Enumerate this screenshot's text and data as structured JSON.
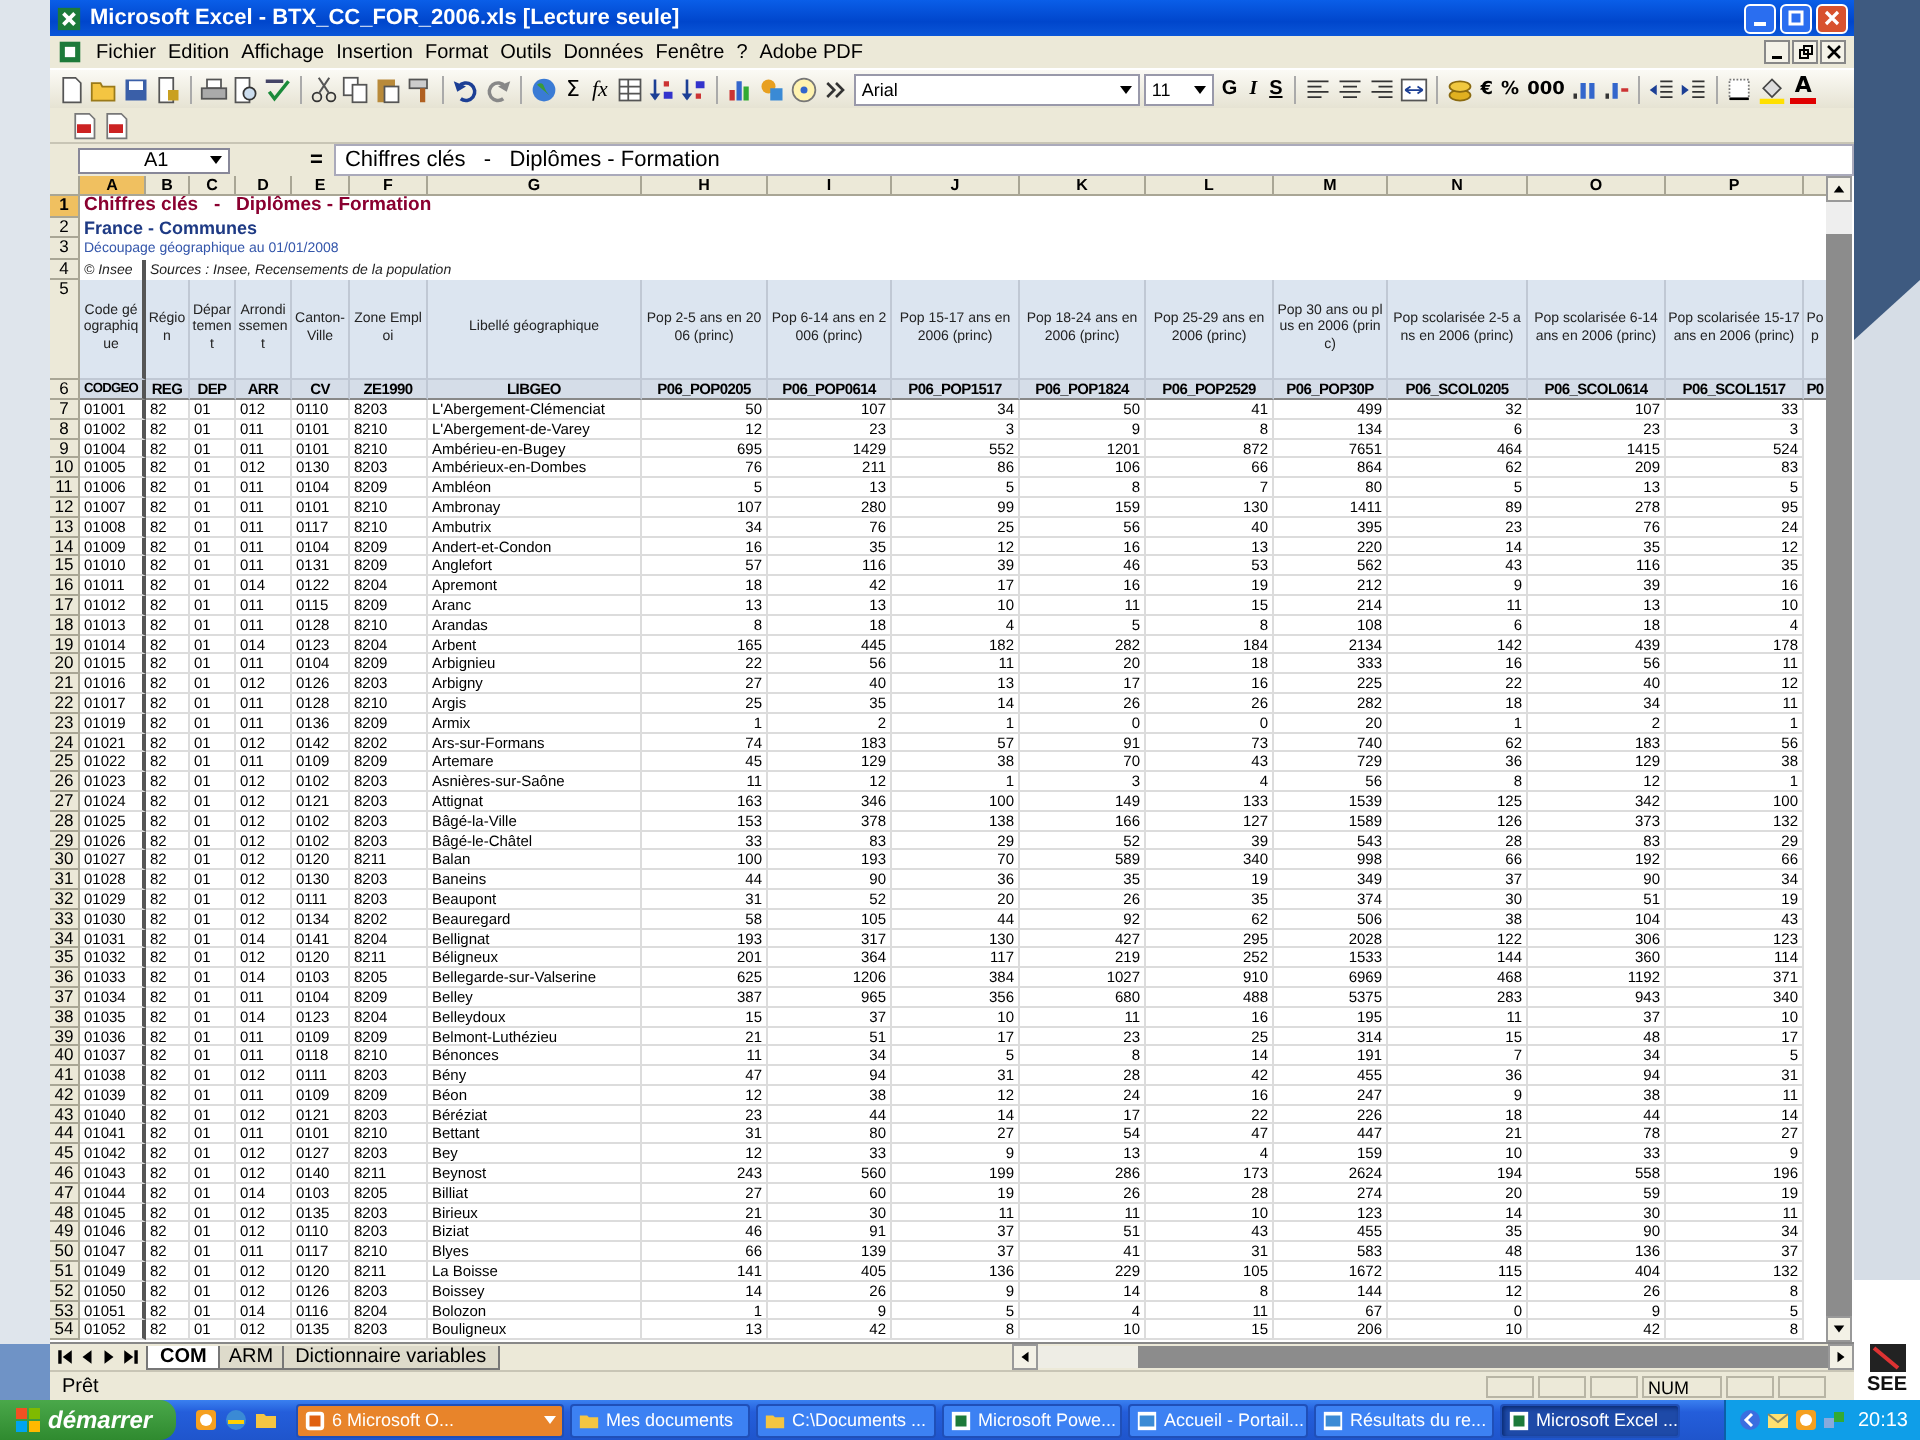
{
  "window": {
    "title": "Microsoft Excel - BTX_CC_FOR_2006.xls  [Lecture seule]"
  },
  "menu": [
    "Fichier",
    "Edition",
    "Affichage",
    "Insertion",
    "Format",
    "Outils",
    "Données",
    "Fenêtre",
    "?",
    "Adobe PDF"
  ],
  "toolbar": {
    "sum": "Σ",
    "function": "fx",
    "font": "Arial",
    "font_size": "11",
    "style_buttons": [
      "G",
      "I",
      "S"
    ],
    "number_buttons": [
      "€",
      "%",
      "000"
    ],
    "font_color": "A"
  },
  "formula_bar": {
    "name_box": "A1",
    "equals": "=",
    "content": "Chiffres clés   -   Diplômes - Formation"
  },
  "columns": [
    {
      "letter": "A",
      "selected": true
    },
    {
      "letter": "B",
      "selected": false
    },
    {
      "letter": "C",
      "selected": false
    },
    {
      "letter": "D",
      "selected": false
    },
    {
      "letter": "E",
      "selected": false
    },
    {
      "letter": "F",
      "selected": false
    },
    {
      "letter": "G",
      "selected": false
    },
    {
      "letter": "H",
      "selected": false
    },
    {
      "letter": "I",
      "selected": false
    },
    {
      "letter": "J",
      "selected": false
    },
    {
      "letter": "K",
      "selected": false
    },
    {
      "letter": "L",
      "selected": false
    },
    {
      "letter": "M",
      "selected": false
    },
    {
      "letter": "N",
      "selected": false
    },
    {
      "letter": "O",
      "selected": false
    },
    {
      "letter": "P",
      "selected": false
    }
  ],
  "title_rows": [
    {
      "row": "1",
      "kind": "title",
      "text": "Chiffres clés   -   Diplômes - Formation",
      "selected": true
    },
    {
      "row": "2",
      "kind": "subtitle",
      "text": "France - Communes",
      "selected": false
    },
    {
      "row": "3",
      "kind": "note",
      "text": "Découpage géographique au 01/01/2008",
      "selected": false
    },
    {
      "row": "4",
      "kind": "source",
      "copyright": "© Insee",
      "text": "Sources : Insee, Recensements de la population",
      "selected": false
    }
  ],
  "header_row": {
    "row": "5",
    "labels": [
      "Code géographique",
      "Région",
      "Département",
      "Arrondissement",
      "Canton-Ville",
      "Zone Emploi",
      "Libellé géographique",
      "Pop 2-5 ans en 2006 (princ)",
      "Pop 6-14 ans en 2006 (princ)",
      "Pop 15-17 ans en 2006 (princ)",
      "Pop 18-24 ans en 2006 (princ)",
      "Pop 25-29 ans en 2006 (princ)",
      "Pop 30 ans ou plus en 2006 (princ)",
      "Pop scolarisée 2-5 ans en 2006 (princ)",
      "Pop scolarisée 6-14 ans en 2006 (princ)",
      "Pop scolarisée 15-17 ans en 2006 (princ)",
      "Pop"
    ]
  },
  "code_row": {
    "row": "6",
    "codes": [
      "CODGEO",
      "REG",
      "DEP",
      "ARR",
      "CV",
      "ZE1990",
      "LIBGEO",
      "P06_POP0205",
      "P06_POP0614",
      "P06_POP1517",
      "P06_POP1824",
      "P06_POP2529",
      "P06_POP30P",
      "P06_SCOL0205",
      "P06_SCOL0614",
      "P06_SCOL1517",
      "P0"
    ]
  },
  "rows": [
    {
      "row": "7",
      "selected": false,
      "cells": [
        "01001",
        "82",
        "01",
        "012",
        "0110",
        "8203",
        "L'Abergement-Clémenciat",
        "50",
        "107",
        "34",
        "50",
        "41",
        "499",
        "32",
        "107",
        "33"
      ]
    },
    {
      "row": "8",
      "selected": false,
      "cells": [
        "01002",
        "82",
        "01",
        "011",
        "0101",
        "8210",
        "L'Abergement-de-Varey",
        "12",
        "23",
        "3",
        "9",
        "8",
        "134",
        "6",
        "23",
        "3"
      ]
    },
    {
      "row": "9",
      "selected": false,
      "cells": [
        "01004",
        "82",
        "01",
        "011",
        "0101",
        "8210",
        "Ambérieu-en-Bugey",
        "695",
        "1429",
        "552",
        "1201",
        "872",
        "7651",
        "464",
        "1415",
        "524"
      ]
    },
    {
      "row": "10",
      "selected": false,
      "cells": [
        "01005",
        "82",
        "01",
        "012",
        "0130",
        "8203",
        "Ambérieux-en-Dombes",
        "76",
        "211",
        "86",
        "106",
        "66",
        "864",
        "62",
        "209",
        "83"
      ]
    },
    {
      "row": "11",
      "selected": false,
      "cells": [
        "01006",
        "82",
        "01",
        "011",
        "0104",
        "8209",
        "Ambléon",
        "5",
        "13",
        "5",
        "8",
        "7",
        "80",
        "5",
        "13",
        "5"
      ]
    },
    {
      "row": "12",
      "selected": false,
      "cells": [
        "01007",
        "82",
        "01",
        "011",
        "0101",
        "8210",
        "Ambronay",
        "107",
        "280",
        "99",
        "159",
        "130",
        "1411",
        "89",
        "278",
        "95"
      ]
    },
    {
      "row": "13",
      "selected": false,
      "cells": [
        "01008",
        "82",
        "01",
        "011",
        "0117",
        "8210",
        "Ambutrix",
        "34",
        "76",
        "25",
        "56",
        "40",
        "395",
        "23",
        "76",
        "24"
      ]
    },
    {
      "row": "14",
      "selected": false,
      "cells": [
        "01009",
        "82",
        "01",
        "011",
        "0104",
        "8209",
        "Andert-et-Condon",
        "16",
        "35",
        "12",
        "16",
        "13",
        "220",
        "14",
        "35",
        "12"
      ]
    },
    {
      "row": "15",
      "selected": false,
      "cells": [
        "01010",
        "82",
        "01",
        "011",
        "0131",
        "8209",
        "Anglefort",
        "57",
        "116",
        "39",
        "46",
        "53",
        "562",
        "43",
        "116",
        "35"
      ]
    },
    {
      "row": "16",
      "selected": false,
      "cells": [
        "01011",
        "82",
        "01",
        "014",
        "0122",
        "8204",
        "Apremont",
        "18",
        "42",
        "17",
        "16",
        "19",
        "212",
        "9",
        "39",
        "16"
      ]
    },
    {
      "row": "17",
      "selected": false,
      "cells": [
        "01012",
        "82",
        "01",
        "011",
        "0115",
        "8209",
        "Aranc",
        "13",
        "13",
        "10",
        "11",
        "15",
        "214",
        "11",
        "13",
        "10"
      ]
    },
    {
      "row": "18",
      "selected": false,
      "cells": [
        "01013",
        "82",
        "01",
        "011",
        "0128",
        "8210",
        "Arandas",
        "8",
        "18",
        "4",
        "5",
        "8",
        "108",
        "6",
        "18",
        "4"
      ]
    },
    {
      "row": "19",
      "selected": false,
      "cells": [
        "01014",
        "82",
        "01",
        "014",
        "0123",
        "8204",
        "Arbent",
        "165",
        "445",
        "182",
        "282",
        "184",
        "2134",
        "142",
        "439",
        "178"
      ]
    },
    {
      "row": "20",
      "selected": false,
      "cells": [
        "01015",
        "82",
        "01",
        "011",
        "0104",
        "8209",
        "Arbignieu",
        "22",
        "56",
        "11",
        "20",
        "18",
        "333",
        "16",
        "56",
        "11"
      ]
    },
    {
      "row": "21",
      "selected": false,
      "cells": [
        "01016",
        "82",
        "01",
        "012",
        "0126",
        "8203",
        "Arbigny",
        "27",
        "40",
        "13",
        "17",
        "16",
        "225",
        "22",
        "40",
        "12"
      ]
    },
    {
      "row": "22",
      "selected": false,
      "cells": [
        "01017",
        "82",
        "01",
        "011",
        "0128",
        "8210",
        "Argis",
        "25",
        "35",
        "14",
        "26",
        "26",
        "282",
        "18",
        "34",
        "11"
      ]
    },
    {
      "row": "23",
      "selected": false,
      "cells": [
        "01019",
        "82",
        "01",
        "011",
        "0136",
        "8209",
        "Armix",
        "1",
        "2",
        "1",
        "0",
        "0",
        "20",
        "1",
        "2",
        "1"
      ]
    },
    {
      "row": "24",
      "selected": false,
      "cells": [
        "01021",
        "82",
        "01",
        "012",
        "0142",
        "8202",
        "Ars-sur-Formans",
        "74",
        "183",
        "57",
        "91",
        "73",
        "740",
        "62",
        "183",
        "56"
      ]
    },
    {
      "row": "25",
      "selected": false,
      "cells": [
        "01022",
        "82",
        "01",
        "011",
        "0109",
        "8209",
        "Artemare",
        "45",
        "129",
        "38",
        "70",
        "43",
        "729",
        "36",
        "129",
        "38"
      ]
    },
    {
      "row": "26",
      "selected": false,
      "cells": [
        "01023",
        "82",
        "01",
        "012",
        "0102",
        "8203",
        "Asnières-sur-Saône",
        "11",
        "12",
        "1",
        "3",
        "4",
        "56",
        "8",
        "12",
        "1"
      ]
    },
    {
      "row": "27",
      "selected": false,
      "cells": [
        "01024",
        "82",
        "01",
        "012",
        "0121",
        "8203",
        "Attignat",
        "163",
        "346",
        "100",
        "149",
        "133",
        "1539",
        "125",
        "342",
        "100"
      ]
    },
    {
      "row": "28",
      "selected": false,
      "cells": [
        "01025",
        "82",
        "01",
        "012",
        "0102",
        "8203",
        "Bâgé-la-Ville",
        "153",
        "378",
        "138",
        "166",
        "127",
        "1589",
        "126",
        "373",
        "132"
      ]
    },
    {
      "row": "29",
      "selected": false,
      "cells": [
        "01026",
        "82",
        "01",
        "012",
        "0102",
        "8203",
        "Bâgé-le-Châtel",
        "33",
        "83",
        "29",
        "52",
        "39",
        "543",
        "28",
        "83",
        "29"
      ]
    },
    {
      "row": "30",
      "selected": false,
      "cells": [
        "01027",
        "82",
        "01",
        "012",
        "0120",
        "8211",
        "Balan",
        "100",
        "193",
        "70",
        "589",
        "340",
        "998",
        "66",
        "192",
        "66"
      ]
    },
    {
      "row": "31",
      "selected": false,
      "cells": [
        "01028",
        "82",
        "01",
        "012",
        "0130",
        "8203",
        "Baneins",
        "44",
        "90",
        "36",
        "35",
        "19",
        "349",
        "37",
        "90",
        "34"
      ]
    },
    {
      "row": "32",
      "selected": false,
      "cells": [
        "01029",
        "82",
        "01",
        "012",
        "0111",
        "8203",
        "Beaupont",
        "31",
        "52",
        "20",
        "26",
        "35",
        "374",
        "30",
        "51",
        "19"
      ]
    },
    {
      "row": "33",
      "selected": false,
      "cells": [
        "01030",
        "82",
        "01",
        "012",
        "0134",
        "8202",
        "Beauregard",
        "58",
        "105",
        "44",
        "92",
        "62",
        "506",
        "38",
        "104",
        "43"
      ]
    },
    {
      "row": "34",
      "selected": false,
      "cells": [
        "01031",
        "82",
        "01",
        "014",
        "0141",
        "8204",
        "Bellignat",
        "193",
        "317",
        "130",
        "427",
        "295",
        "2028",
        "122",
        "306",
        "123"
      ]
    },
    {
      "row": "35",
      "selected": false,
      "cells": [
        "01032",
        "82",
        "01",
        "012",
        "0120",
        "8211",
        "Béligneux",
        "201",
        "364",
        "117",
        "219",
        "252",
        "1533",
        "144",
        "360",
        "114"
      ]
    },
    {
      "row": "36",
      "selected": false,
      "cells": [
        "01033",
        "82",
        "01",
        "014",
        "0103",
        "8205",
        "Bellegarde-sur-Valserine",
        "625",
        "1206",
        "384",
        "1027",
        "910",
        "6969",
        "468",
        "1192",
        "371"
      ]
    },
    {
      "row": "37",
      "selected": false,
      "cells": [
        "01034",
        "82",
        "01",
        "011",
        "0104",
        "8209",
        "Belley",
        "387",
        "965",
        "356",
        "680",
        "488",
        "5375",
        "283",
        "943",
        "340"
      ]
    },
    {
      "row": "38",
      "selected": false,
      "cells": [
        "01035",
        "82",
        "01",
        "014",
        "0123",
        "8204",
        "Belleydoux",
        "15",
        "37",
        "10",
        "11",
        "16",
        "195",
        "11",
        "37",
        "10"
      ]
    },
    {
      "row": "39",
      "selected": false,
      "cells": [
        "01036",
        "82",
        "01",
        "011",
        "0109",
        "8209",
        "Belmont-Luthézieu",
        "21",
        "51",
        "17",
        "23",
        "25",
        "314",
        "15",
        "48",
        "17"
      ]
    },
    {
      "row": "40",
      "selected": false,
      "cells": [
        "01037",
        "82",
        "01",
        "011",
        "0118",
        "8210",
        "Bénonces",
        "11",
        "34",
        "5",
        "8",
        "14",
        "191",
        "7",
        "34",
        "5"
      ]
    },
    {
      "row": "41",
      "selected": false,
      "cells": [
        "01038",
        "82",
        "01",
        "012",
        "0111",
        "8203",
        "Bény",
        "47",
        "94",
        "31",
        "28",
        "42",
        "455",
        "36",
        "94",
        "31"
      ]
    },
    {
      "row": "42",
      "selected": false,
      "cells": [
        "01039",
        "82",
        "01",
        "011",
        "0109",
        "8209",
        "Béon",
        "12",
        "38",
        "12",
        "24",
        "16",
        "247",
        "9",
        "38",
        "11"
      ]
    },
    {
      "row": "43",
      "selected": false,
      "cells": [
        "01040",
        "82",
        "01",
        "012",
        "0121",
        "8203",
        "Béréziat",
        "23",
        "44",
        "14",
        "17",
        "22",
        "226",
        "18",
        "44",
        "14"
      ]
    },
    {
      "row": "44",
      "selected": false,
      "cells": [
        "01041",
        "82",
        "01",
        "011",
        "0101",
        "8210",
        "Bettant",
        "31",
        "80",
        "27",
        "54",
        "47",
        "447",
        "21",
        "78",
        "27"
      ]
    },
    {
      "row": "45",
      "selected": false,
      "cells": [
        "01042",
        "82",
        "01",
        "012",
        "0127",
        "8203",
        "Bey",
        "12",
        "33",
        "9",
        "13",
        "4",
        "159",
        "10",
        "33",
        "9"
      ]
    },
    {
      "row": "46",
      "selected": false,
      "cells": [
        "01043",
        "82",
        "01",
        "012",
        "0140",
        "8211",
        "Beynost",
        "243",
        "560",
        "199",
        "286",
        "173",
        "2624",
        "194",
        "558",
        "196"
      ]
    },
    {
      "row": "47",
      "selected": false,
      "cells": [
        "01044",
        "82",
        "01",
        "014",
        "0103",
        "8205",
        "Billiat",
        "27",
        "60",
        "19",
        "26",
        "28",
        "274",
        "20",
        "59",
        "19"
      ]
    },
    {
      "row": "48",
      "selected": false,
      "cells": [
        "01045",
        "82",
        "01",
        "012",
        "0135",
        "8203",
        "Birieux",
        "21",
        "30",
        "11",
        "11",
        "10",
        "123",
        "14",
        "30",
        "11"
      ]
    },
    {
      "row": "49",
      "selected": false,
      "cells": [
        "01046",
        "82",
        "01",
        "012",
        "0110",
        "8203",
        "Biziat",
        "46",
        "91",
        "37",
        "51",
        "43",
        "455",
        "35",
        "90",
        "34"
      ]
    },
    {
      "row": "50",
      "selected": false,
      "cells": [
        "01047",
        "82",
        "01",
        "011",
        "0117",
        "8210",
        "Blyes",
        "66",
        "139",
        "37",
        "41",
        "31",
        "583",
        "48",
        "136",
        "37"
      ]
    },
    {
      "row": "51",
      "selected": false,
      "cells": [
        "01049",
        "82",
        "01",
        "012",
        "0120",
        "8211",
        "La Boisse",
        "141",
        "405",
        "136",
        "229",
        "105",
        "1672",
        "115",
        "404",
        "132"
      ]
    },
    {
      "row": "52",
      "selected": false,
      "cells": [
        "01050",
        "82",
        "01",
        "012",
        "0126",
        "8203",
        "Boissey",
        "14",
        "26",
        "9",
        "14",
        "8",
        "144",
        "12",
        "26",
        "8"
      ]
    },
    {
      "row": "53",
      "selected": false,
      "cells": [
        "01051",
        "82",
        "01",
        "014",
        "0116",
        "8204",
        "Bolozon",
        "1",
        "9",
        "5",
        "4",
        "11",
        "67",
        "0",
        "9",
        "5"
      ]
    },
    {
      "row": "54",
      "selected": false,
      "cells": [
        "01052",
        "82",
        "01",
        "012",
        "0135",
        "8203",
        "Bouligneux",
        "13",
        "42",
        "8",
        "10",
        "15",
        "206",
        "10",
        "42",
        "8"
      ]
    }
  ],
  "sheet_tabs": [
    {
      "label": "COM",
      "selected": true
    },
    {
      "label": "ARM",
      "selected": false
    },
    {
      "label": "Dictionnaire variables",
      "selected": false
    }
  ],
  "status_bar": {
    "text": "Prêt",
    "num": "NUM"
  },
  "taskbar": {
    "start": "démarrer",
    "tasks": [
      {
        "label": "6 Microsoft O...",
        "kind": "group",
        "selected": false
      },
      {
        "label": "Mes documents",
        "kind": "folder",
        "selected": false
      },
      {
        "label": "C:\\Documents ...",
        "kind": "folder",
        "selected": false
      },
      {
        "label": "Microsoft Powe...",
        "kind": "app",
        "selected": false
      },
      {
        "label": "Accueil - Portail...",
        "kind": "browser",
        "selected": false
      },
      {
        "label": "Résultats du re...",
        "kind": "browser",
        "selected": false
      },
      {
        "label": "Microsoft Excel ...",
        "kind": "app",
        "selected": true
      }
    ],
    "clock": "20:13"
  },
  "logo": {
    "text": "SEE"
  }
}
